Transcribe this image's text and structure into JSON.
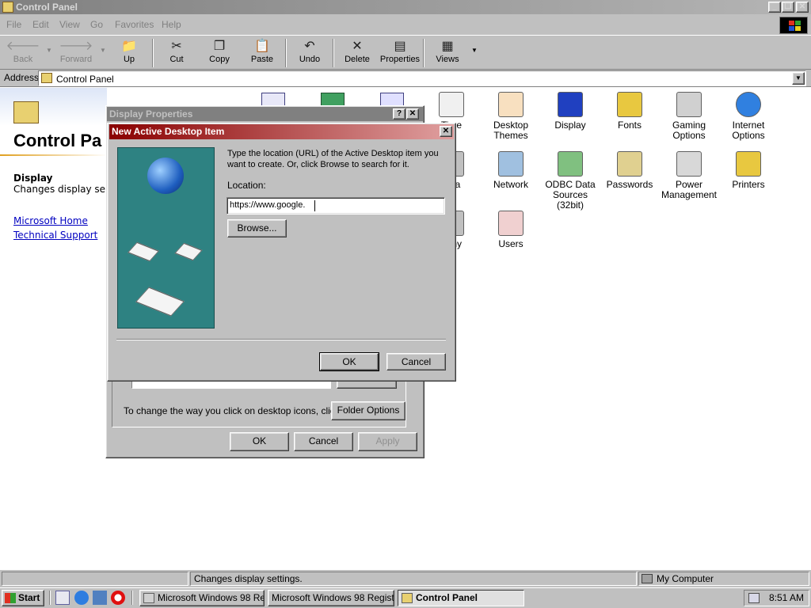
{
  "window": {
    "title": "Control Panel",
    "menu": [
      "File",
      "Edit",
      "View",
      "Go",
      "Favorites",
      "Help"
    ]
  },
  "toolbar": {
    "back": "Back",
    "forward": "Forward",
    "up": "Up",
    "cut": "Cut",
    "copy": "Copy",
    "paste": "Paste",
    "undo": "Undo",
    "delete": "Delete",
    "properties": "Properties",
    "views": "Views"
  },
  "address": {
    "label": "Address",
    "value": "Control Panel"
  },
  "left_panel": {
    "title": "Control Pa",
    "selected_name": "Display",
    "selected_desc": "Changes display set",
    "links": [
      "Microsoft Home",
      "Technical Support"
    ]
  },
  "icons": [
    {
      "label": "Time",
      "color": "#c03030"
    },
    {
      "label": "Desktop Themes",
      "color": "#e04020"
    },
    {
      "label": "Display",
      "color": "#2040c0"
    },
    {
      "label": "Fonts",
      "color": "#e8c840"
    },
    {
      "label": "Gaming Options",
      "color": "#a0a0a0"
    },
    {
      "label": "Internet Options",
      "color": "#3080e0"
    },
    {
      "label": "edia",
      "color": "#606060"
    },
    {
      "label": "Network",
      "color": "#2060a0"
    },
    {
      "label": "ODBC Data Sources (32bit)",
      "color": "#40a040"
    },
    {
      "label": "Passwords",
      "color": "#c0a040"
    },
    {
      "label": "Power Management",
      "color": "#909090"
    },
    {
      "label": "Printers",
      "color": "#e8c840"
    },
    {
      "label": "hony",
      "color": "#808080"
    },
    {
      "label": "Users",
      "color": "#c03030"
    }
  ],
  "display_properties": {
    "title": "Display Properties",
    "click_text": "To change the way you click on desktop icons, click:",
    "folder_options": "Folder Options",
    "ok": "OK",
    "cancel": "Cancel",
    "apply": "Apply"
  },
  "new_item": {
    "title": "New Active Desktop Item",
    "instructions": "Type the location (URL) of the Active Desktop item you want to create. Or, click Browse to search for it.",
    "location_label": "Location:",
    "location_value": "https://www.google.",
    "browse": "Browse...",
    "ok": "OK",
    "cancel": "Cancel"
  },
  "statusbar": {
    "message": "Changes display settings.",
    "zone": "My Computer"
  },
  "taskbar": {
    "start": "Start",
    "tasks": [
      "Microsoft Windows 98 Re...",
      "Microsoft Windows 98 Registr...",
      "Control Panel"
    ],
    "clock": "8:51 AM"
  }
}
